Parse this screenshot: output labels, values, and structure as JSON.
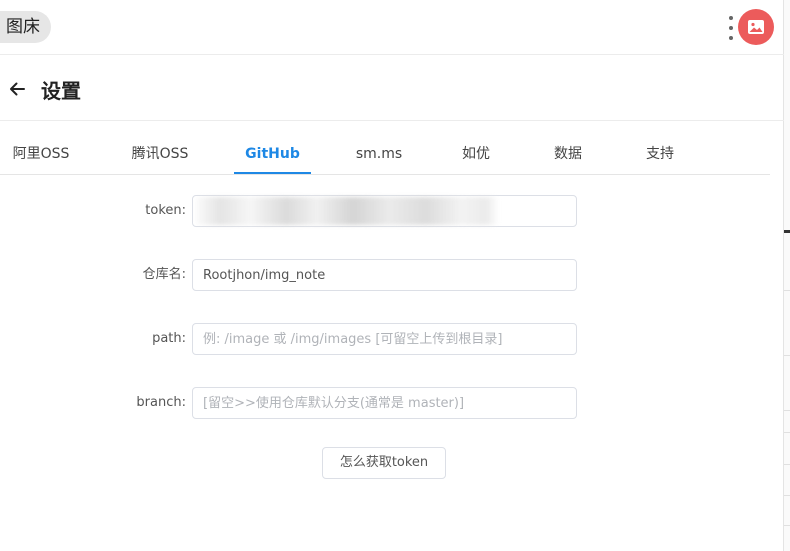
{
  "app": {
    "chip_label": "图床",
    "icons": {
      "menu": "more-vertical-icon",
      "extension": "image-icon"
    },
    "colors": {
      "extension_bg": "#ec5b5b",
      "accent": "#1e88e5"
    }
  },
  "header": {
    "title": "设置",
    "back_icon": "arrow-left-icon"
  },
  "tabs": [
    {
      "label": "阿里OSS",
      "active": false
    },
    {
      "label": "腾讯OSS",
      "active": false
    },
    {
      "label": "GitHub",
      "active": true
    },
    {
      "label": "sm.ms",
      "active": false
    },
    {
      "label": "如优",
      "active": false
    },
    {
      "label": "数据",
      "active": false
    },
    {
      "label": "支持",
      "active": false
    }
  ],
  "form": {
    "token": {
      "label": "token:",
      "value": "",
      "redacted": true
    },
    "repo": {
      "label": "仓库名:",
      "value": "Rootjhon/img_note"
    },
    "path": {
      "label": "path:",
      "value": "",
      "placeholder": "例: /image 或 /img/images [可留空上传到根目录]"
    },
    "branch": {
      "label": "branch:",
      "value": "",
      "placeholder": "[留空>>使用仓库默认分支(通常是 master)]"
    },
    "help_button": "怎么获取token"
  }
}
